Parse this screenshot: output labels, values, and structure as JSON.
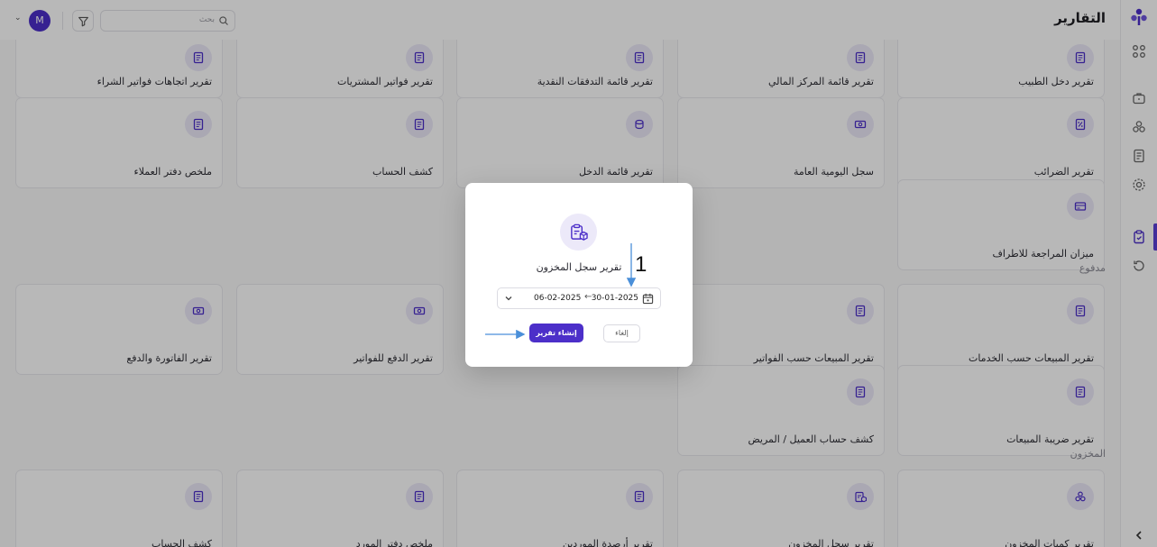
{
  "header": {
    "title": "التقارير",
    "search_placeholder": "بحث",
    "avatar_initial": "M"
  },
  "sections": {
    "paid": "مدفوع",
    "inventory": "المخزون"
  },
  "cards": [
    {
      "label": "تقرير دخل الطبيب",
      "icon": "document-icon"
    },
    {
      "label": "تقرير قائمة المركز المالي",
      "icon": "document-icon"
    },
    {
      "label": "تقرير قائمة التدفقات النقدية",
      "icon": "document-icon"
    },
    {
      "label": "تقرير فواتير المشتريات",
      "icon": "document-icon"
    },
    {
      "label": "تقرير اتجاهات فواتير الشراء",
      "icon": "document-icon"
    },
    {
      "label": "تقرير الضرائب",
      "icon": "tax-icon"
    },
    {
      "label": "سجل اليومية العامة",
      "icon": "cash-icon"
    },
    {
      "label": "تقرير قائمة الدخل",
      "icon": "coins-icon"
    },
    {
      "label": "كشف الحساب",
      "icon": "document-icon"
    },
    {
      "label": "ملخص دفتر العملاء",
      "icon": "document-icon"
    },
    {
      "label": "ميزان المراجعة للاطراف",
      "icon": "card-icon"
    },
    {
      "label": "تقرير المبيعات حسب الخدمات",
      "icon": "document-icon"
    },
    {
      "label": "تقرير المبيعات حسب الفواتير",
      "icon": "document-icon"
    },
    {
      "label": "تقرير الدفع للفواتير",
      "icon": "cash-icon"
    },
    {
      "label": "تقرير الفاتورة والدفع",
      "icon": "cash-icon"
    },
    {
      "label": "تقرير ضريبة المبيعات",
      "icon": "document-icon"
    },
    {
      "label": "كشف حساب العميل / المريض",
      "icon": "document-icon"
    },
    {
      "label": "تقرير كميات المخزون",
      "icon": "boxes-icon"
    },
    {
      "label": "تقرير سجل المخزون",
      "icon": "clipboard-box-icon"
    },
    {
      "label": "تقرير أرصدة الموردين",
      "icon": "document-icon"
    },
    {
      "label": "ملخص دفتر المورد",
      "icon": "document-icon"
    },
    {
      "label": "كشف الحساب",
      "icon": "document-icon"
    }
  ],
  "modal": {
    "title": "تقرير سجل المخزون",
    "icon": "clipboard-box-icon",
    "date_from": "30-01-2025",
    "date_arrow": "←",
    "date_to": "06-02-2025",
    "create_label": "إنشاء تقرير",
    "cancel_label": "إلغاء"
  },
  "annotation": {
    "step_number": "1",
    "arrow_color": "#4a8fd9"
  },
  "colors": {
    "accent": "#4c2fc9",
    "icon_bg": "#ece9f9"
  }
}
